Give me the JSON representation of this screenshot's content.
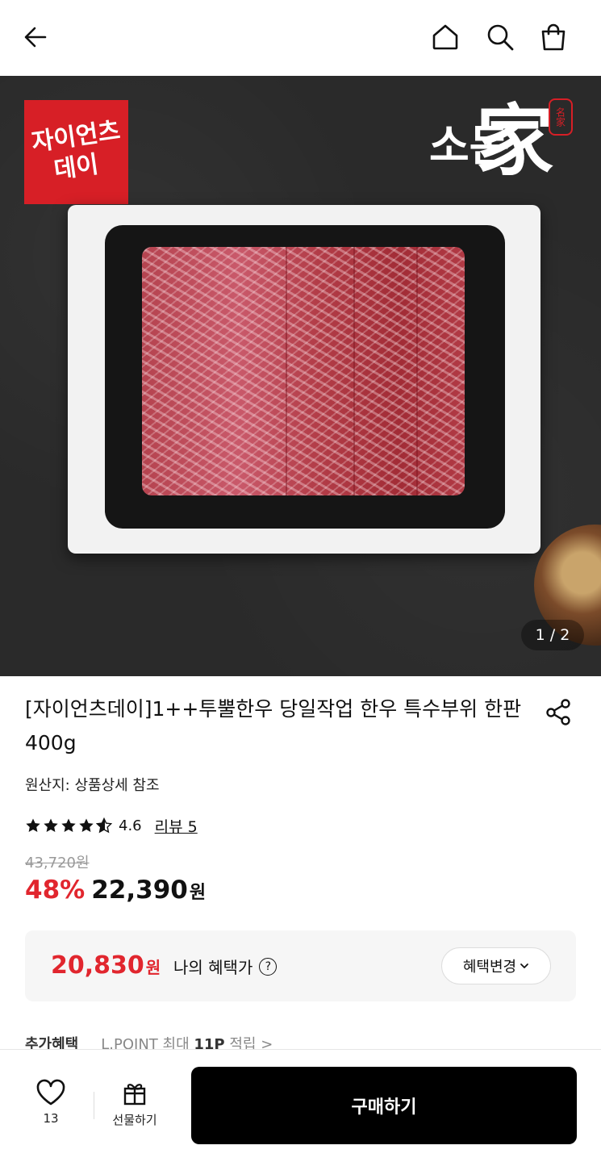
{
  "header": {
    "back_icon": "arrow-left-icon",
    "home_icon": "home-icon",
    "search_icon": "search-icon",
    "cart_icon": "shopping-bag-icon"
  },
  "hero": {
    "brand_badge_line1": "자이언츠",
    "brand_badge_line2": "데이",
    "logo_text_1": "소돈",
    "logo_text_2": "家",
    "seal_text": "名家",
    "counter": "1 / 2"
  },
  "product": {
    "title": "[자이언츠데이]1++투뿔한우 당일작업 한우 특수부위 한판 400g",
    "origin": "원산지: 상품상세 참조",
    "rating_value": 4.6,
    "rating_text": "4.6",
    "review_link": "리뷰 5",
    "original_price": "43,720원",
    "discount": "48%",
    "price": "22,390",
    "price_unit": "원"
  },
  "benefit": {
    "price": "20,830",
    "unit": "원",
    "label": "나의 혜택가",
    "help_icon": "question-circle-icon",
    "help_glyph": "?",
    "change_button": "혜택변경"
  },
  "extra_benefits": {
    "label": "추가혜택",
    "point_prefix": "L.POINT 최대",
    "point_amount": "11P",
    "point_suffix": "적립 >"
  },
  "bottom_bar": {
    "like_count": "13",
    "gift_label": "선물하기",
    "buy_label": "구매하기"
  },
  "colors": {
    "accent_red": "#e1262e",
    "buy_button": "#000000",
    "badge_red": "#d71f26"
  }
}
